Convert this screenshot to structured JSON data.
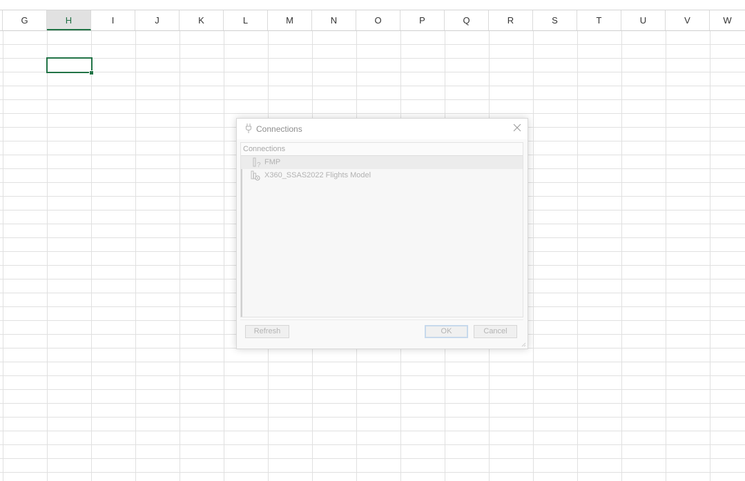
{
  "sheet": {
    "columns": [
      "G",
      "H",
      "I",
      "J",
      "K",
      "L",
      "M",
      "N",
      "O",
      "P",
      "Q",
      "R",
      "S",
      "T",
      "U",
      "V",
      "W"
    ],
    "active_column": "H"
  },
  "dialog": {
    "title": "Connections",
    "list_header": "Connections",
    "items": [
      {
        "label": "FMP",
        "icon": "connection-unknown-icon",
        "selected": true
      },
      {
        "label": "X360_SSAS2022 Flights Model",
        "icon": "data-model-connection-icon",
        "selected": false
      }
    ],
    "buttons": {
      "refresh": "Refresh",
      "ok": "OK",
      "cancel": "Cancel"
    }
  },
  "colors": {
    "accent": "#217346"
  }
}
